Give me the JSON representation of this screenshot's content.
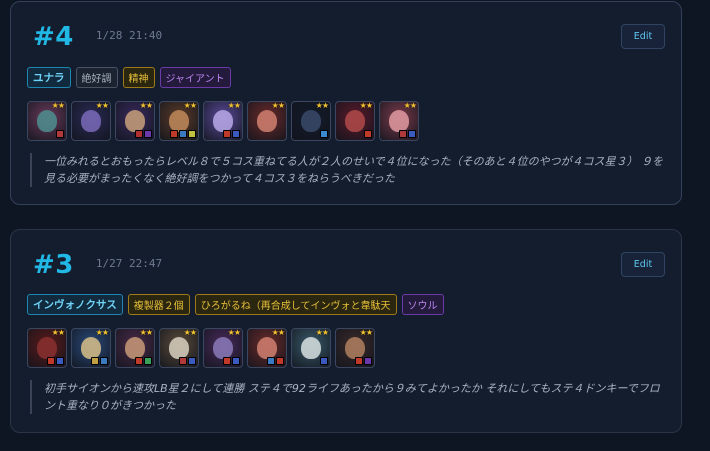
{
  "cards": [
    {
      "rank": "#4",
      "time": "1/28 21:40",
      "edit_label": "Edit",
      "tags": [
        {
          "label": "ユナラ",
          "style": "main"
        },
        {
          "label": "絶好調",
          "style": "gray"
        },
        {
          "label": "精神",
          "style": "gold"
        },
        {
          "label": "ジャイアント",
          "style": "purple"
        }
      ],
      "champions": [
        {
          "stars": "★★",
          "bg": "#6a3a5a",
          "face": "#4c8e8e",
          "items": [
            "#b03a3a"
          ]
        },
        {
          "stars": "★★",
          "bg": "#2b2a55",
          "face": "#7a6ab8",
          "items": []
        },
        {
          "stars": "★★",
          "bg": "#3a2a5e",
          "face": "#c8a07a",
          "items": [
            "#b03030",
            "#6a38a8"
          ]
        },
        {
          "stars": "★★",
          "bg": "#5a3a28",
          "face": "#c08a5a",
          "items": [
            "#c03a2a",
            "#3a7ac0",
            "#c0c040"
          ]
        },
        {
          "stars": "★★",
          "bg": "#5a4a98",
          "face": "#b8a8e8",
          "items": [
            "#c03a2a",
            "#3a5ac0"
          ]
        },
        {
          "stars": "★★",
          "bg": "#6a2a2a",
          "face": "#d08070",
          "items": []
        },
        {
          "stars": "★★",
          "bg": "#141a2a",
          "face": "#3a4a6a",
          "items": [
            "#3a8ad0"
          ]
        },
        {
          "stars": "★★",
          "bg": "#5a1a2a",
          "face": "#b04a4a",
          "items": [
            "#c03a2a"
          ]
        },
        {
          "stars": "★★",
          "bg": "#7a3a4a",
          "face": "#e09aa0",
          "items": [
            "#b03a3a",
            "#3a5ac0"
          ]
        }
      ],
      "note": "一位みれるとおもったらレベル８で５コス重ねてる人が２人のせいで４位になった（そのあと４位のやつが４コス星３） ９を見る必要がまったくなく絶好調をつかって４コス３をねらうべきだった"
    },
    {
      "rank": "#3",
      "time": "1/27 22:47",
      "edit_label": "Edit",
      "tags": [
        {
          "label": "インヴォノクサス",
          "style": "main"
        },
        {
          "label": "複製器２個",
          "style": "gold"
        },
        {
          "label": "ひろがるね（再合成してインヴォと韋駄天",
          "style": "gold"
        },
        {
          "label": "ソウル",
          "style": "purple"
        }
      ],
      "champions": [
        {
          "stars": "★★",
          "bg": "#5a1a1a",
          "face": "#8a3030",
          "items": [
            "#c03a2a",
            "#3a5ac0"
          ]
        },
        {
          "stars": "★★",
          "bg": "#2a4a7a",
          "face": "#d8c088",
          "items": [
            "#c0a040",
            "#3a7ac0"
          ]
        },
        {
          "stars": "★★",
          "bg": "#4a2a48",
          "face": "#c89a78",
          "items": [
            "#c03a2a",
            "#3aa05a"
          ]
        },
        {
          "stars": "★★",
          "bg": "#5a4a3a",
          "face": "#d8d0c0",
          "items": [
            "#b03a3a",
            "#3a5ac0"
          ]
        },
        {
          "stars": "★★",
          "bg": "#4a2a5a",
          "face": "#8a7ab8",
          "items": [
            "#c03a2a",
            "#3a5ac0"
          ]
        },
        {
          "stars": "★★",
          "bg": "#6a2a2a",
          "face": "#d08070",
          "items": [
            "#3a7ac0",
            "#c03a2a"
          ]
        },
        {
          "stars": "★★",
          "bg": "#3a5a6a",
          "face": "#d8e0e0",
          "items": [
            "#3a5ac0"
          ]
        },
        {
          "stars": "★★",
          "bg": "#3a2a2a",
          "face": "#b08060",
          "items": [
            "#c03a2a",
            "#6a38a8"
          ]
        }
      ],
      "note": "初手サイオンから速攻LB星２にして連勝 ステ４で92ライフあったから９みてよかったか それにしてもステ４ドンキーでフロント重なり０がきつかった"
    }
  ]
}
